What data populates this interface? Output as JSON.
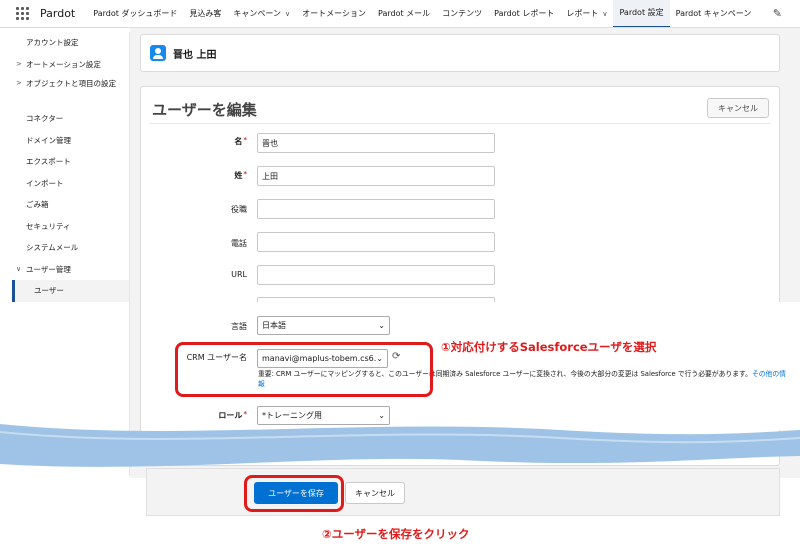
{
  "topnav": {
    "app_name": "Pardot",
    "items": [
      {
        "label": "Pardot ダッシュボード",
        "dropdown": false
      },
      {
        "label": "見込み客",
        "dropdown": false
      },
      {
        "label": "キャンペーン",
        "dropdown": true
      },
      {
        "label": "オートメーション",
        "dropdown": false
      },
      {
        "label": "Pardot メール",
        "dropdown": false
      },
      {
        "label": "コンテンツ",
        "dropdown": false
      },
      {
        "label": "Pardot レポート",
        "dropdown": false
      },
      {
        "label": "レポート",
        "dropdown": true
      },
      {
        "label": "Pardot 設定",
        "dropdown": false,
        "active": true
      },
      {
        "label": "Pardot キャンペーン",
        "dropdown": false
      }
    ]
  },
  "sidebar": {
    "items": [
      {
        "label": "アカウント設定"
      },
      {
        "label": "オートメーション設定",
        "caret": ">"
      },
      {
        "label": "オブジェクトと項目の設定",
        "caret": ">"
      },
      {
        "label": "コネクター"
      },
      {
        "label": "ドメイン管理"
      },
      {
        "label": "エクスポート"
      },
      {
        "label": "インポート"
      },
      {
        "label": "ごみ箱"
      },
      {
        "label": "セキュリティ"
      },
      {
        "label": "システムメール"
      },
      {
        "label": "ユーザー管理",
        "caret": "∨"
      },
      {
        "label": "ユーザー"
      }
    ]
  },
  "header": {
    "user_name": "晋也 上田"
  },
  "edit": {
    "title": "ユーザーを編集",
    "cancel_label": "キャンセル",
    "fields": {
      "first_name": {
        "label": "名",
        "value": "晋也"
      },
      "last_name": {
        "label": "姓",
        "value": "上田"
      },
      "job_title": {
        "label": "役職",
        "value": ""
      },
      "phone": {
        "label": "電話",
        "value": ""
      },
      "url": {
        "label": "URL",
        "value": ""
      },
      "language": {
        "label": "言語",
        "value": "日本語"
      },
      "crm_user": {
        "label": "CRM ユーザー名",
        "value": "manavi@maplus-tobem.cs6."
      },
      "role": {
        "label": "ロール",
        "value": "*トレーニング用"
      }
    },
    "note_text": "重要: CRM ユーザーにマッピングすると、このユーザーは同期済み Salesforce ユーザーに変換され、今後の大部分の変更は Salesforce で行う必要があります。",
    "note_link": "その他の情報"
  },
  "footer": {
    "save_label": "ユーザーを保存",
    "cancel_label": "キャンセル"
  },
  "annotations": {
    "step1": "①対応付けするSalesforceユーザを選択",
    "step2": "②ユーザーを保存をクリック"
  },
  "colors": {
    "accent": "#0070d2",
    "annotation_red": "#e01a1a",
    "wave_blue": "#9ec3e6"
  }
}
